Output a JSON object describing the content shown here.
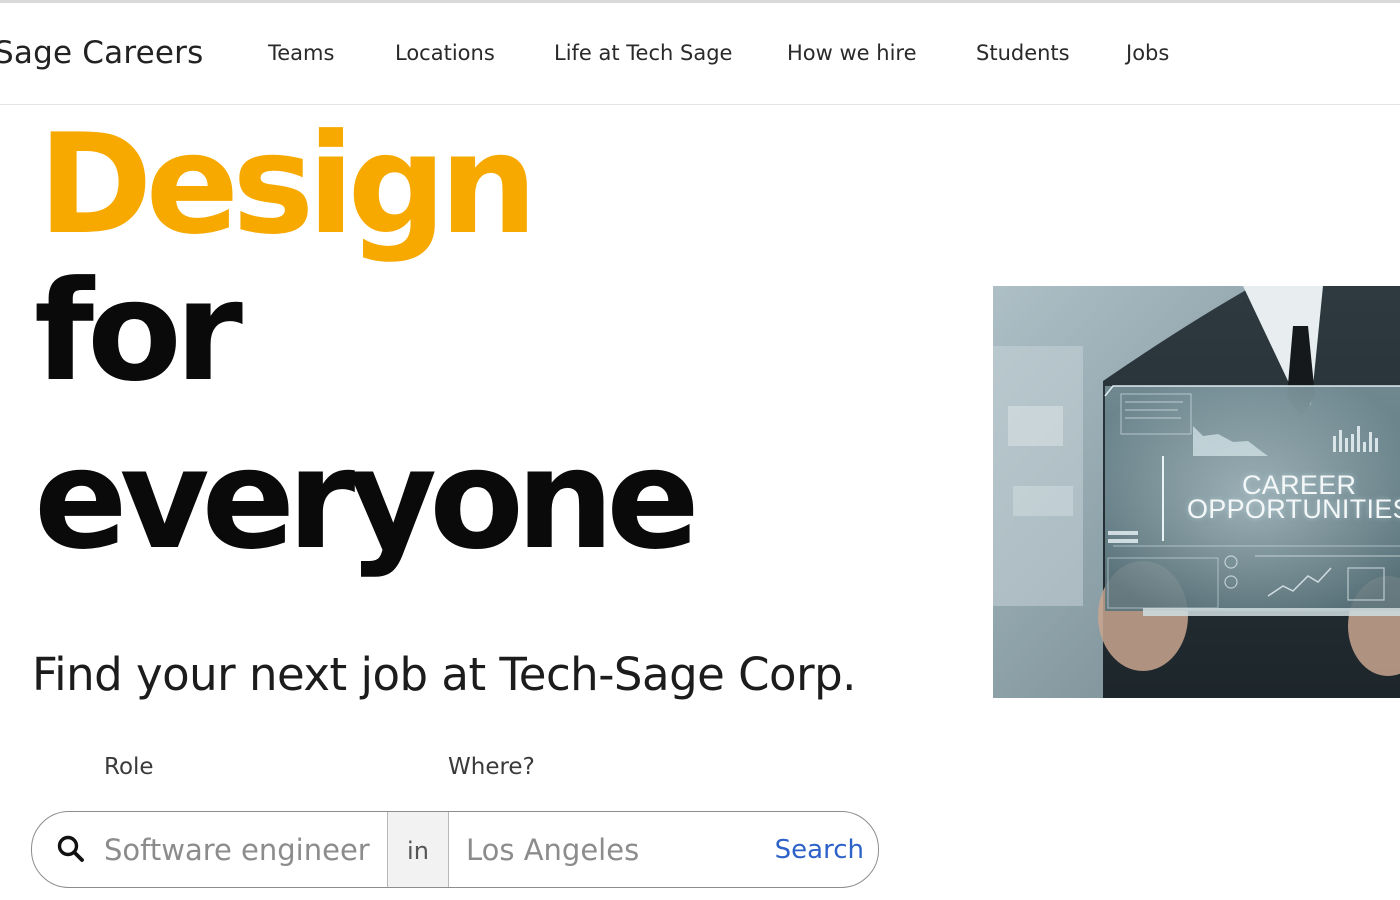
{
  "brand": "Sage Careers",
  "nav": [
    "Teams",
    "Locations",
    "Life at Tech Sage",
    "How we hire",
    "Students",
    "Jobs"
  ],
  "hero": {
    "line1": "Design",
    "line2": "for",
    "line3": "everyone",
    "subtitle": "Find your next job at Tech-Sage Corp.",
    "accent_color": "#f7a900"
  },
  "search": {
    "role_label": "Role",
    "where_label": "Where?",
    "role_placeholder": "Software engineer",
    "in_text": "in",
    "where_placeholder": "Los Angeles",
    "button_label": "Search",
    "search_icon": "search-icon",
    "button_color": "#2f62c9"
  },
  "image": {
    "line1": "CAREER",
    "line2": "OPPORTUNITIES"
  }
}
